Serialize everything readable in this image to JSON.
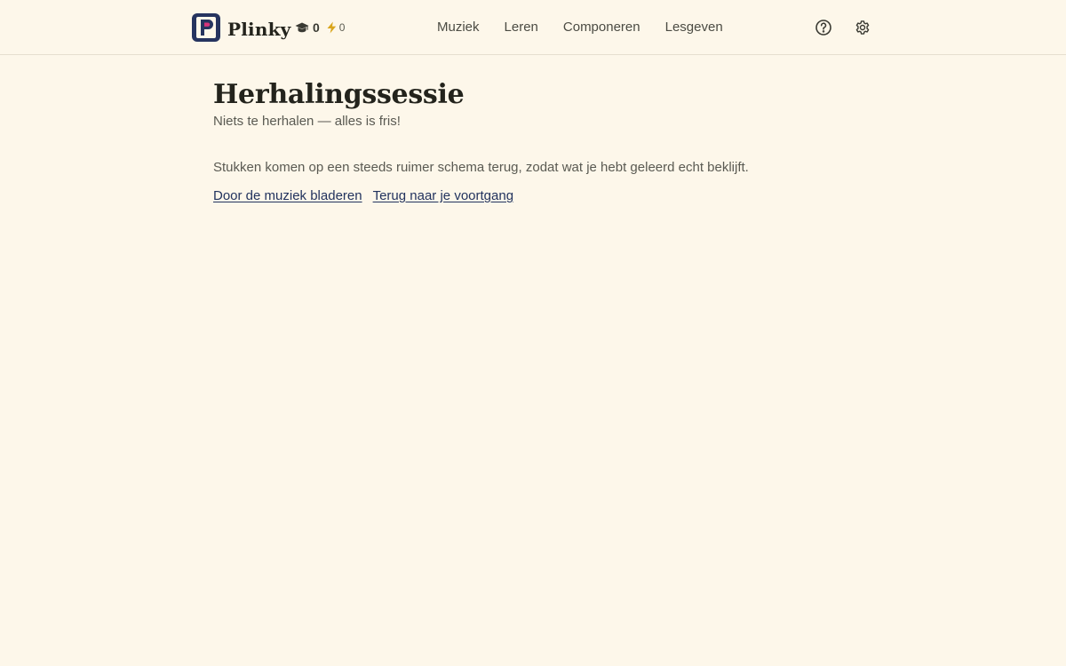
{
  "app": {
    "name": "Plinky",
    "logo_icon": "plinky-logo-icon"
  },
  "header": {
    "stats": {
      "xp_icon": "graduation-cap-icon",
      "xp_value": "0",
      "streak_icon": "lightning-bolt-icon",
      "streak_value": "0"
    },
    "nav": [
      {
        "label": "Muziek"
      },
      {
        "label": "Leren"
      },
      {
        "label": "Componeren"
      },
      {
        "label": "Lesgeven"
      }
    ],
    "icons": {
      "help": "help-circle-icon",
      "settings": "gear-icon"
    }
  },
  "main": {
    "title": "Herhalingssessie",
    "subtitle": "Niets te herhalen — alles is fris!",
    "description": "Stukken komen op een steeds ruimer schema terug, zodat wat je hebt geleerd echt beklijft.",
    "links": [
      {
        "label": "Door de muziek bladeren"
      },
      {
        "label": "Terug naar je voortgang"
      }
    ]
  },
  "colors": {
    "background": "#fdf7ea",
    "logo_navy": "#26345f",
    "logo_accent": "#d6337a",
    "link": "#22335e",
    "divider": "#e6dfcf"
  }
}
